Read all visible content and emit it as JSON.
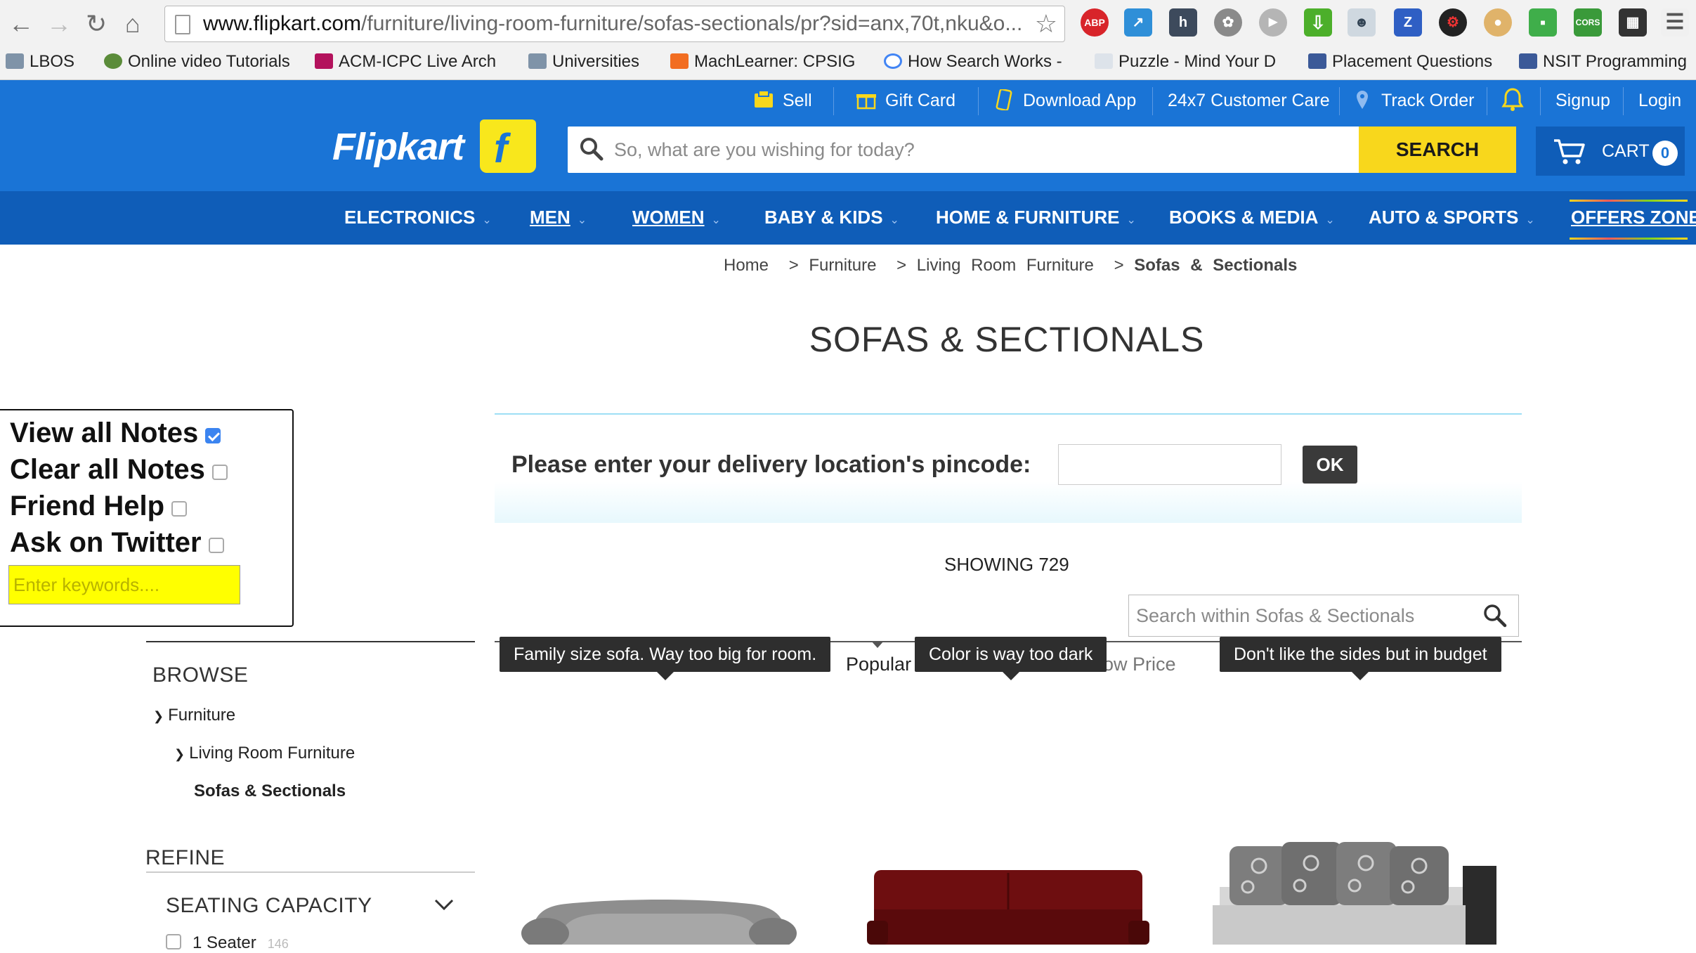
{
  "browser": {
    "url_host": "www.flipkart.com",
    "url_path": "/furniture/living-room-furniture/sofas-sectionals/pr?sid=anx,70t,nku&o...",
    "bookmarks": [
      "LBOS",
      "Online video Tutorials",
      "ACM-ICPC Live Arch",
      "Universities",
      "MachLearner: CPSIG",
      "How Search Works -",
      "Puzzle - Mind Your D",
      "Placement Questions",
      "NSIT Programming"
    ],
    "ext_labels": {
      "abp": "ABP",
      "h": "h",
      "z": "Z",
      "cors": "CORS"
    }
  },
  "header": {
    "util": {
      "sell": "Sell",
      "gift_card": "Gift Card",
      "download_app": "Download App",
      "customer_care": "24x7 Customer Care",
      "track_order": "Track Order",
      "signup": "Signup",
      "login": "Login"
    },
    "logo": "Flipkart",
    "search_placeholder": "So, what are you wishing for today?",
    "search_button": "SEARCH",
    "cart_label": "CART",
    "cart_count": "0"
  },
  "nav": [
    "ELECTRONICS",
    "MEN",
    "WOMEN",
    "BABY & KIDS",
    "HOME & FURNITURE",
    "BOOKS & MEDIA",
    "AUTO & SPORTS",
    "OFFERS ZONE"
  ],
  "breadcrumb": {
    "home": "Home",
    "c1": "Furniture",
    "c2": "Living Room Furniture",
    "c3": "Sofas & Sectionals",
    "sep": ">"
  },
  "page_title": "SOFAS & SECTIONALS",
  "notes_panel": {
    "view_all": "View all Notes",
    "clear_all": "Clear all Notes",
    "friend_help": "Friend Help",
    "ask_twitter": "Ask on Twitter",
    "keywords_placeholder": "Enter keywords...."
  },
  "pincode": {
    "label": "Please enter your delivery location's pincode:",
    "ok": "OK"
  },
  "showing": "SHOWING 729",
  "search_within_placeholder": "Search within Sofas & Sectionals",
  "sort": {
    "popular": "Popular",
    "low_price": "ow Price"
  },
  "tooltips": [
    "Family size sofa. Way too big for room.",
    "Color is way too dark",
    "Don't like the sides but in budget"
  ],
  "sidebar": {
    "browse": "BROWSE",
    "tree": [
      "Furniture",
      "Living Room Furniture",
      "Sofas & Sectionals"
    ],
    "refine": "REFINE",
    "seating": "SEATING CAPACITY",
    "seater_1": "1 Seater",
    "seater_1_count": "146"
  },
  "colors": {
    "brand_blue": "#1a74d6",
    "nav_blue": "#0f5db8",
    "search_yellow": "#f8d71c",
    "tooltip_bg": "#2e2e2e"
  }
}
